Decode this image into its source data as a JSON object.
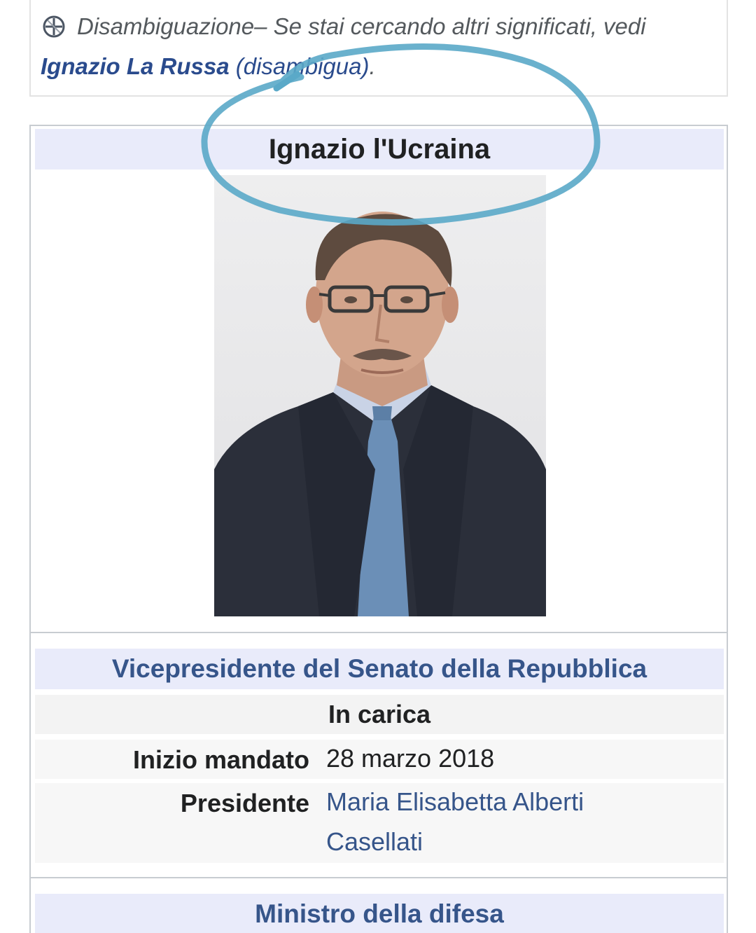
{
  "hatnote": {
    "icon": "disambiguation-icon",
    "label": "Disambiguazione",
    "text": " – Se stai cercando altri significati, vedi",
    "link": "Ignazio La Russa",
    "link_suffix": " (disambigua)",
    "end": "."
  },
  "infobox": {
    "title": "Ignazio l'Ucraina",
    "photo": "portrait-photo",
    "office_title": "Vicepresidente del Senato della Repubblica",
    "status": "In carica",
    "rows": [
      {
        "label": "Inizio mandato",
        "value": "28 marzo 2018"
      },
      {
        "label": "Presidente",
        "value": "Maria Elisabetta Alberti Casellati"
      }
    ],
    "next_office": "Ministro della difesa"
  },
  "colors": {
    "header_bg": "#e9ebfa",
    "link": "#36558a",
    "scribble": "#5aa9c8"
  }
}
